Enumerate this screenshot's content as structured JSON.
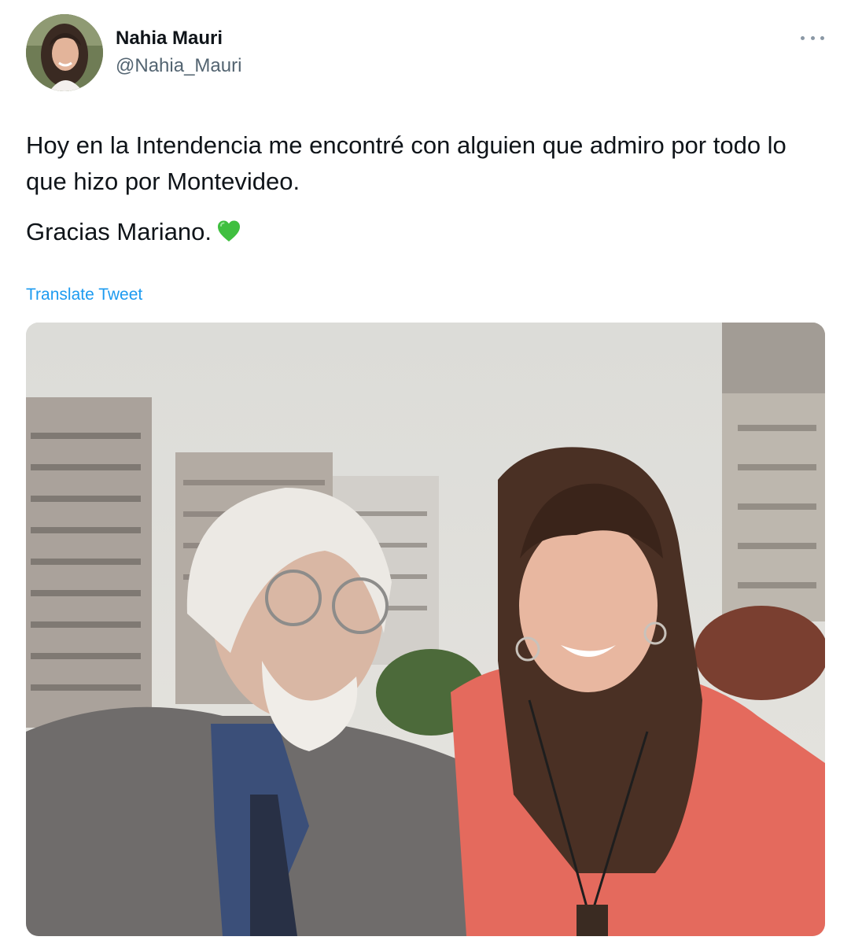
{
  "author": {
    "display_name": "Nahia Mauri",
    "handle": "@Nahia_Mauri"
  },
  "tweet": {
    "line1": "Hoy en la Intendencia me encontré con alguien que admiro por todo lo que hizo por Montevideo.",
    "line2": "Gracias Mariano.",
    "emoji": "green-heart"
  },
  "actions": {
    "translate_label": "Translate Tweet"
  },
  "colors": {
    "link": "#1d9bf0",
    "secondary_text": "#536471",
    "primary_text": "#0f1419",
    "heart": "#3fbf3f"
  }
}
